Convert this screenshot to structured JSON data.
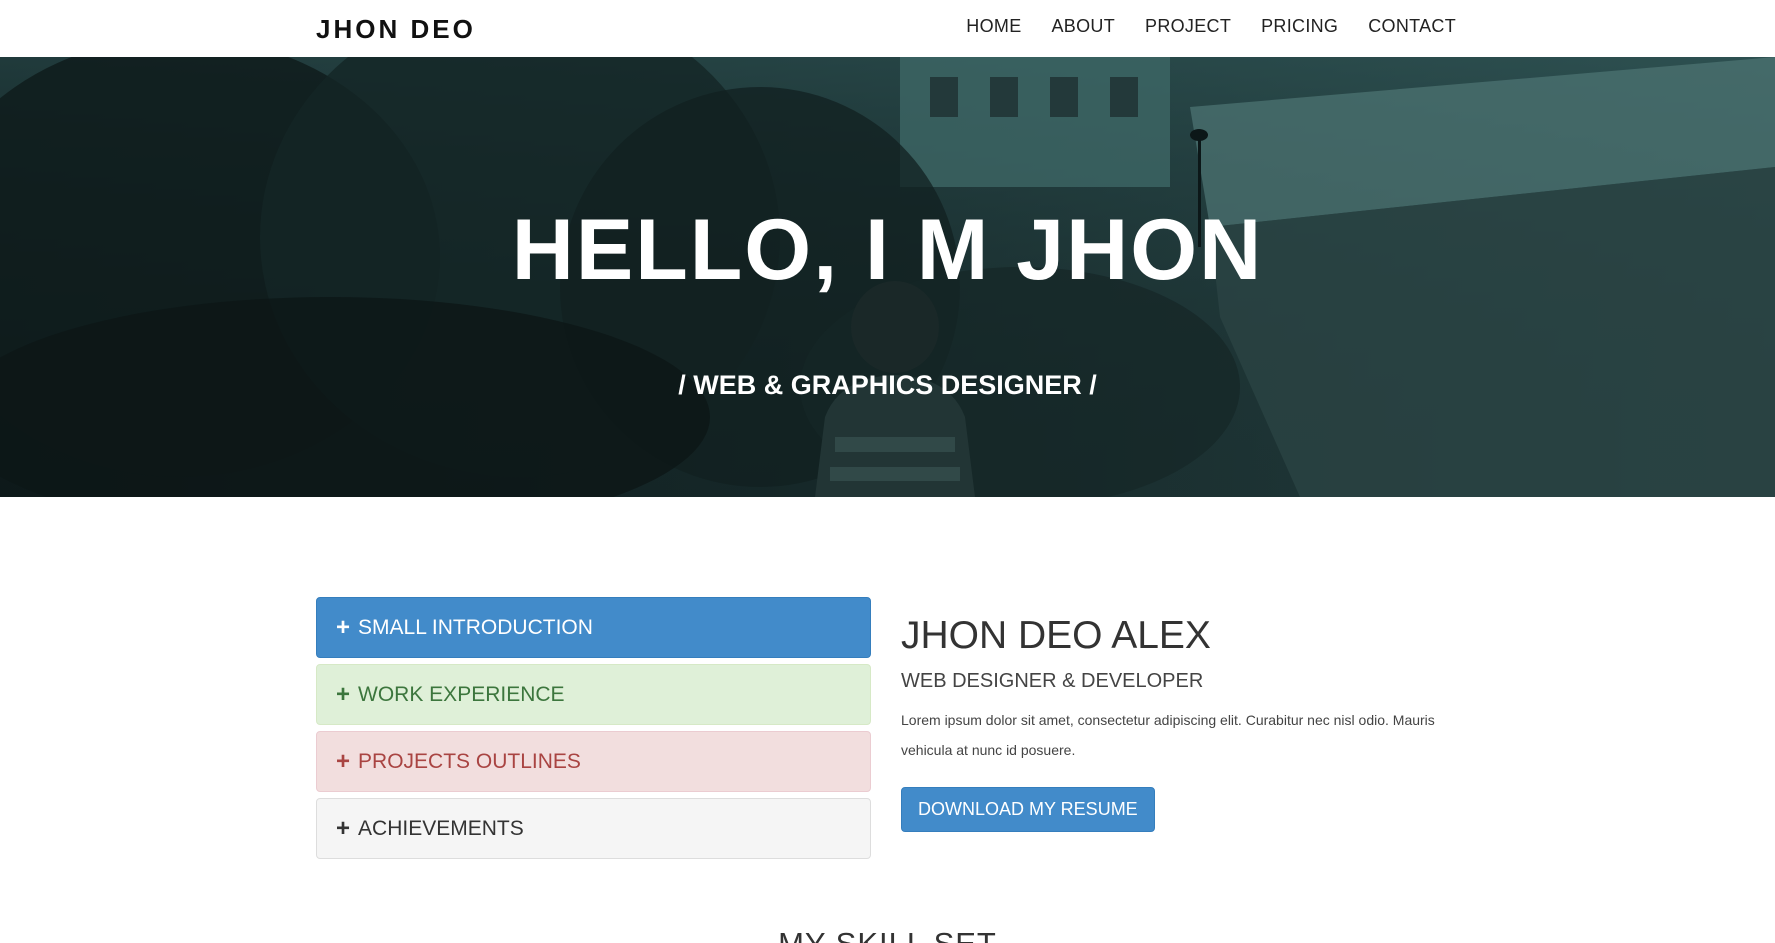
{
  "brand": "JHON DEO",
  "nav": [
    "HOME",
    "ABOUT",
    "PROJECT",
    "PRICING",
    "CONTACT"
  ],
  "hero": {
    "title": "HELLO, I M JHON",
    "subtitle": "/ WEB & GRAPHICS DESIGNER /"
  },
  "accordion": [
    {
      "icon": "plus-icon",
      "label": "SMALL INTRODUCTION",
      "color": "#428bca"
    },
    {
      "icon": "plus-icon",
      "label": "WORK EXPERIENCE",
      "color": "#dff0d8"
    },
    {
      "icon": "plus-icon",
      "label": "PROJECTS OUTLINES",
      "color": "#f2dede"
    },
    {
      "icon": "plus-icon",
      "label": "ACHIEVEMENTS",
      "color": "#f5f5f5"
    }
  ],
  "profile": {
    "name": "JHON DEO ALEX",
    "role": "WEB DESIGNER & DEVELOPER",
    "text": "Lorem ipsum dolor sit amet, consectetur adipiscing elit. Curabitur nec nisl odio. Mauris vehicula at nunc id posuere.",
    "button": "DOWNLOAD MY RESUME"
  },
  "skills_title": "MY SKILL SET",
  "colors": {
    "primary": "#428bca",
    "hero_tint": "#1e3a3a"
  }
}
